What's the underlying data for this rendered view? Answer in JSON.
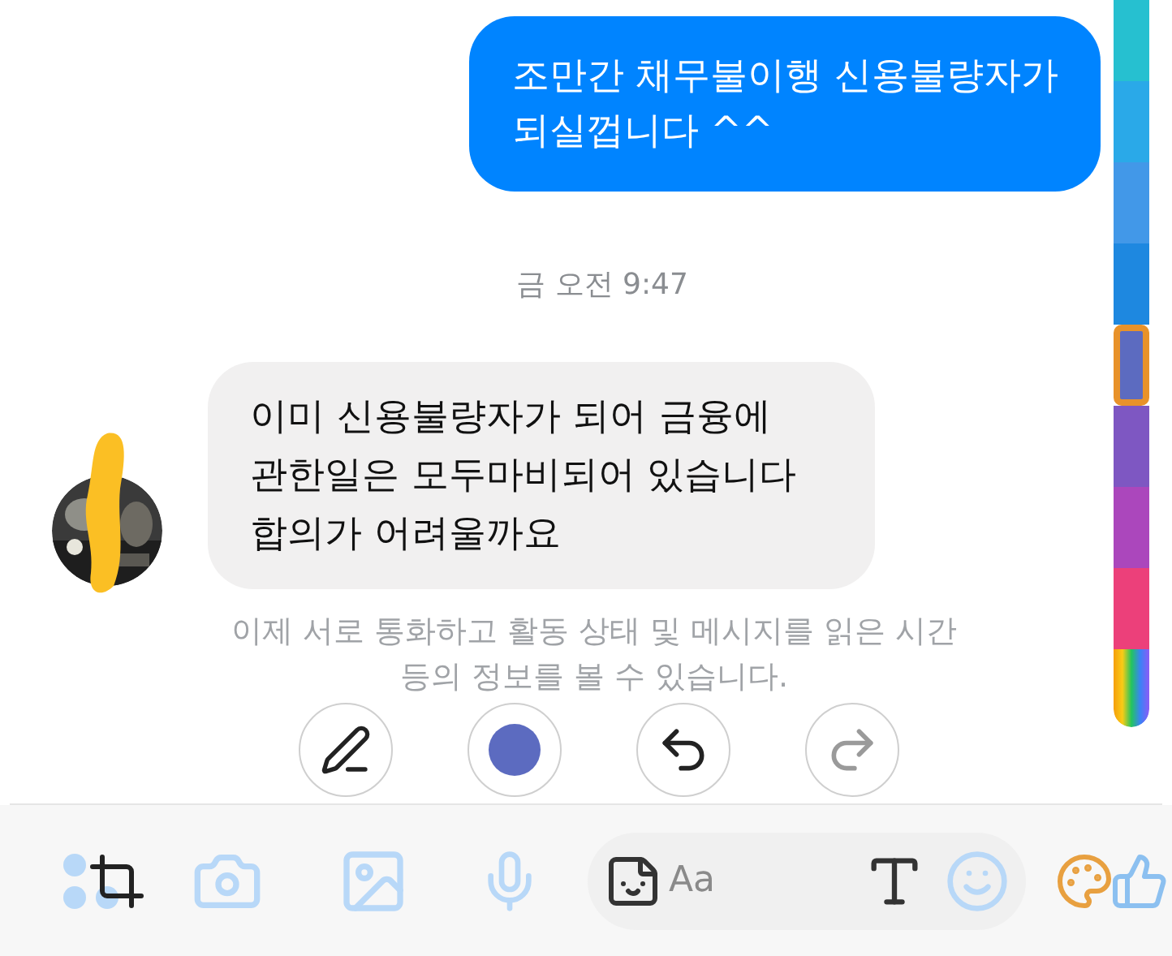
{
  "messages": [
    {
      "kind": "outgoing",
      "text": "조만간 채무불이행 신용불량자가\n되실껍니다 ^^"
    },
    {
      "kind": "timestamp",
      "text": "금 오전 9:47"
    },
    {
      "kind": "incoming",
      "text": "이미 신용불량자가 되어 금융에\n관한일은 모두마비되어 있습니다\n합의가 어려울까요"
    },
    {
      "kind": "info",
      "text": "이제 서로 통화하고 활동 상태 및 메시지를 읽은 시간\n등의 정보를 볼 수 있습니다."
    }
  ],
  "tools": [
    {
      "kind": "pen",
      "disabled": false
    },
    {
      "kind": "color",
      "disabled": false
    },
    {
      "kind": "undo",
      "disabled": false
    },
    {
      "kind": "redo",
      "disabled": true
    }
  ],
  "palette": [
    {
      "kind": "solid",
      "color": "#26c0d0",
      "selected": false
    },
    {
      "kind": "solid",
      "color": "#2aa9e8",
      "selected": false
    },
    {
      "kind": "solid",
      "color": "#4298e8",
      "selected": false
    },
    {
      "kind": "solid",
      "color": "#1e88e0",
      "selected": false
    },
    {
      "kind": "solid",
      "color": "#5c6bc0",
      "selected": true
    },
    {
      "kind": "solid",
      "color": "#7e57c2",
      "selected": false
    },
    {
      "kind": "solid",
      "color": "#ab47bc",
      "selected": false
    },
    {
      "kind": "solid",
      "color": "#ec407a",
      "selected": false
    },
    {
      "kind": "rainbow",
      "selected": false
    }
  ],
  "composer": {
    "placeholder": "Aa"
  }
}
